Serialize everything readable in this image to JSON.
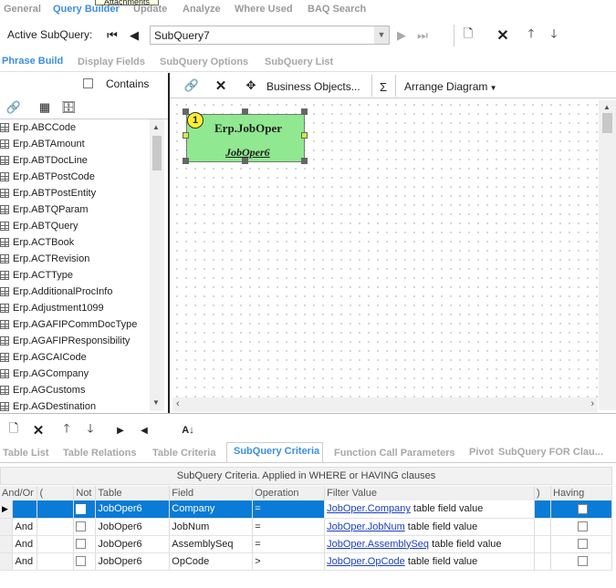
{
  "top_tabs": [
    "General",
    "Query Builder",
    "Update",
    "Analyze",
    "Where Used",
    "BAQ Search"
  ],
  "tooltip": "Attachments",
  "active_subquery": {
    "label": "Active SubQuery:",
    "value": "SubQuery7"
  },
  "phrase_tabs": [
    "Phrase Build",
    "Display Fields",
    "SubQuery Options",
    "SubQuery List"
  ],
  "contains_label": "Contains",
  "diagram_toolbar": {
    "business_objects": "Business Objects...",
    "sigma": "Σ",
    "arrange": "Arrange Diagram"
  },
  "tables": [
    "Erp.ABCCode",
    "Erp.ABTAmount",
    "Erp.ABTDocLine",
    "Erp.ABTPostCode",
    "Erp.ABTPostEntity",
    "Erp.ABTQParam",
    "Erp.ABTQuery",
    "Erp.ACTBook",
    "Erp.ACTRevision",
    "Erp.ACTType",
    "Erp.AdditionalProcInfo",
    "Erp.Adjustment1099",
    "Erp.AGAFIPCommDocType",
    "Erp.AGAFIPResponsibility",
    "Erp.AGCAICode",
    "Erp.AGCompany",
    "Erp.AGCustoms",
    "Erp.AGDestination"
  ],
  "diagram_node": {
    "number": "1",
    "title": "Erp.JobOper",
    "alias": "JobOper6"
  },
  "bottom_tabs": [
    "Table List",
    "Table Relations",
    "Table Criteria",
    "SubQuery Criteria",
    "Function Call Parameters",
    "Pivot",
    "SubQuery FOR Clau..."
  ],
  "criteria_caption": "SubQuery Criteria. Applied in WHERE or HAVING clauses",
  "criteria_headers": [
    "And/Or",
    "(",
    "Not",
    "Table",
    "Field",
    "Operation",
    "Filter Value",
    ")",
    "Having"
  ],
  "criteria_rows": [
    {
      "andor": "",
      "table": "JobOper6",
      "field": "Company",
      "op": "=",
      "fv_link": "JobOper.Company",
      "fv_text": " table field value"
    },
    {
      "andor": "And",
      "table": "JobOper6",
      "field": "JobNum",
      "op": "=",
      "fv_link": "JobOper.JobNum",
      "fv_text": " table field value"
    },
    {
      "andor": "And",
      "table": "JobOper6",
      "field": "AssemblySeq",
      "op": "=",
      "fv_link": "JobOper.AssemblySeq",
      "fv_text": " table field value"
    },
    {
      "andor": "And",
      "table": "JobOper6",
      "field": "OpCode",
      "op": ">",
      "fv_link": "JobOper.OpCode",
      "fv_text": " table field value"
    }
  ],
  "colors": {
    "accent": "#3d8ee0",
    "selection": "#0a7bd6",
    "node_fill": "#90e890"
  }
}
